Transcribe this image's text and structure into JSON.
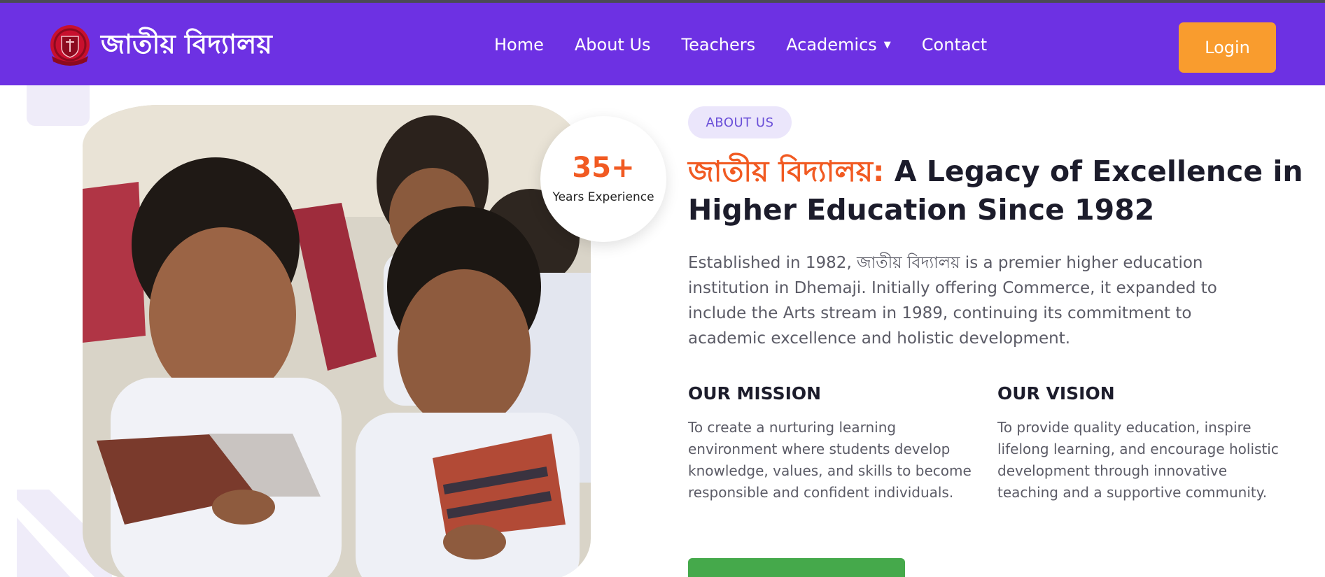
{
  "header": {
    "brand_name": "জাতীয় বিদ্যালয়",
    "nav": [
      {
        "label": "Home"
      },
      {
        "label": "About Us"
      },
      {
        "label": "Teachers"
      },
      {
        "label": "Academics",
        "has_dropdown": true
      },
      {
        "label": "Contact"
      }
    ],
    "login_label": "Login"
  },
  "badge": {
    "number": "35+",
    "label": "Years Experience"
  },
  "about": {
    "pill": "ABOUT US",
    "headline_accent": "জাতীয় বিদ্যালয়:",
    "headline_rest": "A Legacy of Excellence in Higher Education Since 1982",
    "intro": "Established in 1982, জাতীয় বিদ্যালয় is a premier higher education institution in Dhemaji. Initially offering Commerce, it expanded to include the Arts stream in 1989, continuing its commitment to academic excellence and holistic development.",
    "mission": {
      "title": "OUR MISSION",
      "text": "To create a nurturing learning environment where students develop knowledge, values, and skills to become responsible and confident individuals."
    },
    "vision": {
      "title": "OUR VISION",
      "text": "To provide quality education, inspire lifelong learning, and encourage holistic development through innovative teaching and a supportive community."
    }
  },
  "colors": {
    "nav_bg": "#6d31e3",
    "login_bg": "#f99c2e",
    "accent_orange": "#f15a22",
    "pill_bg": "#ebe6fb",
    "cta_green": "#45a94b"
  },
  "icons": {
    "logo": "school-crest-icon",
    "dropdown": "caret-down-icon"
  }
}
